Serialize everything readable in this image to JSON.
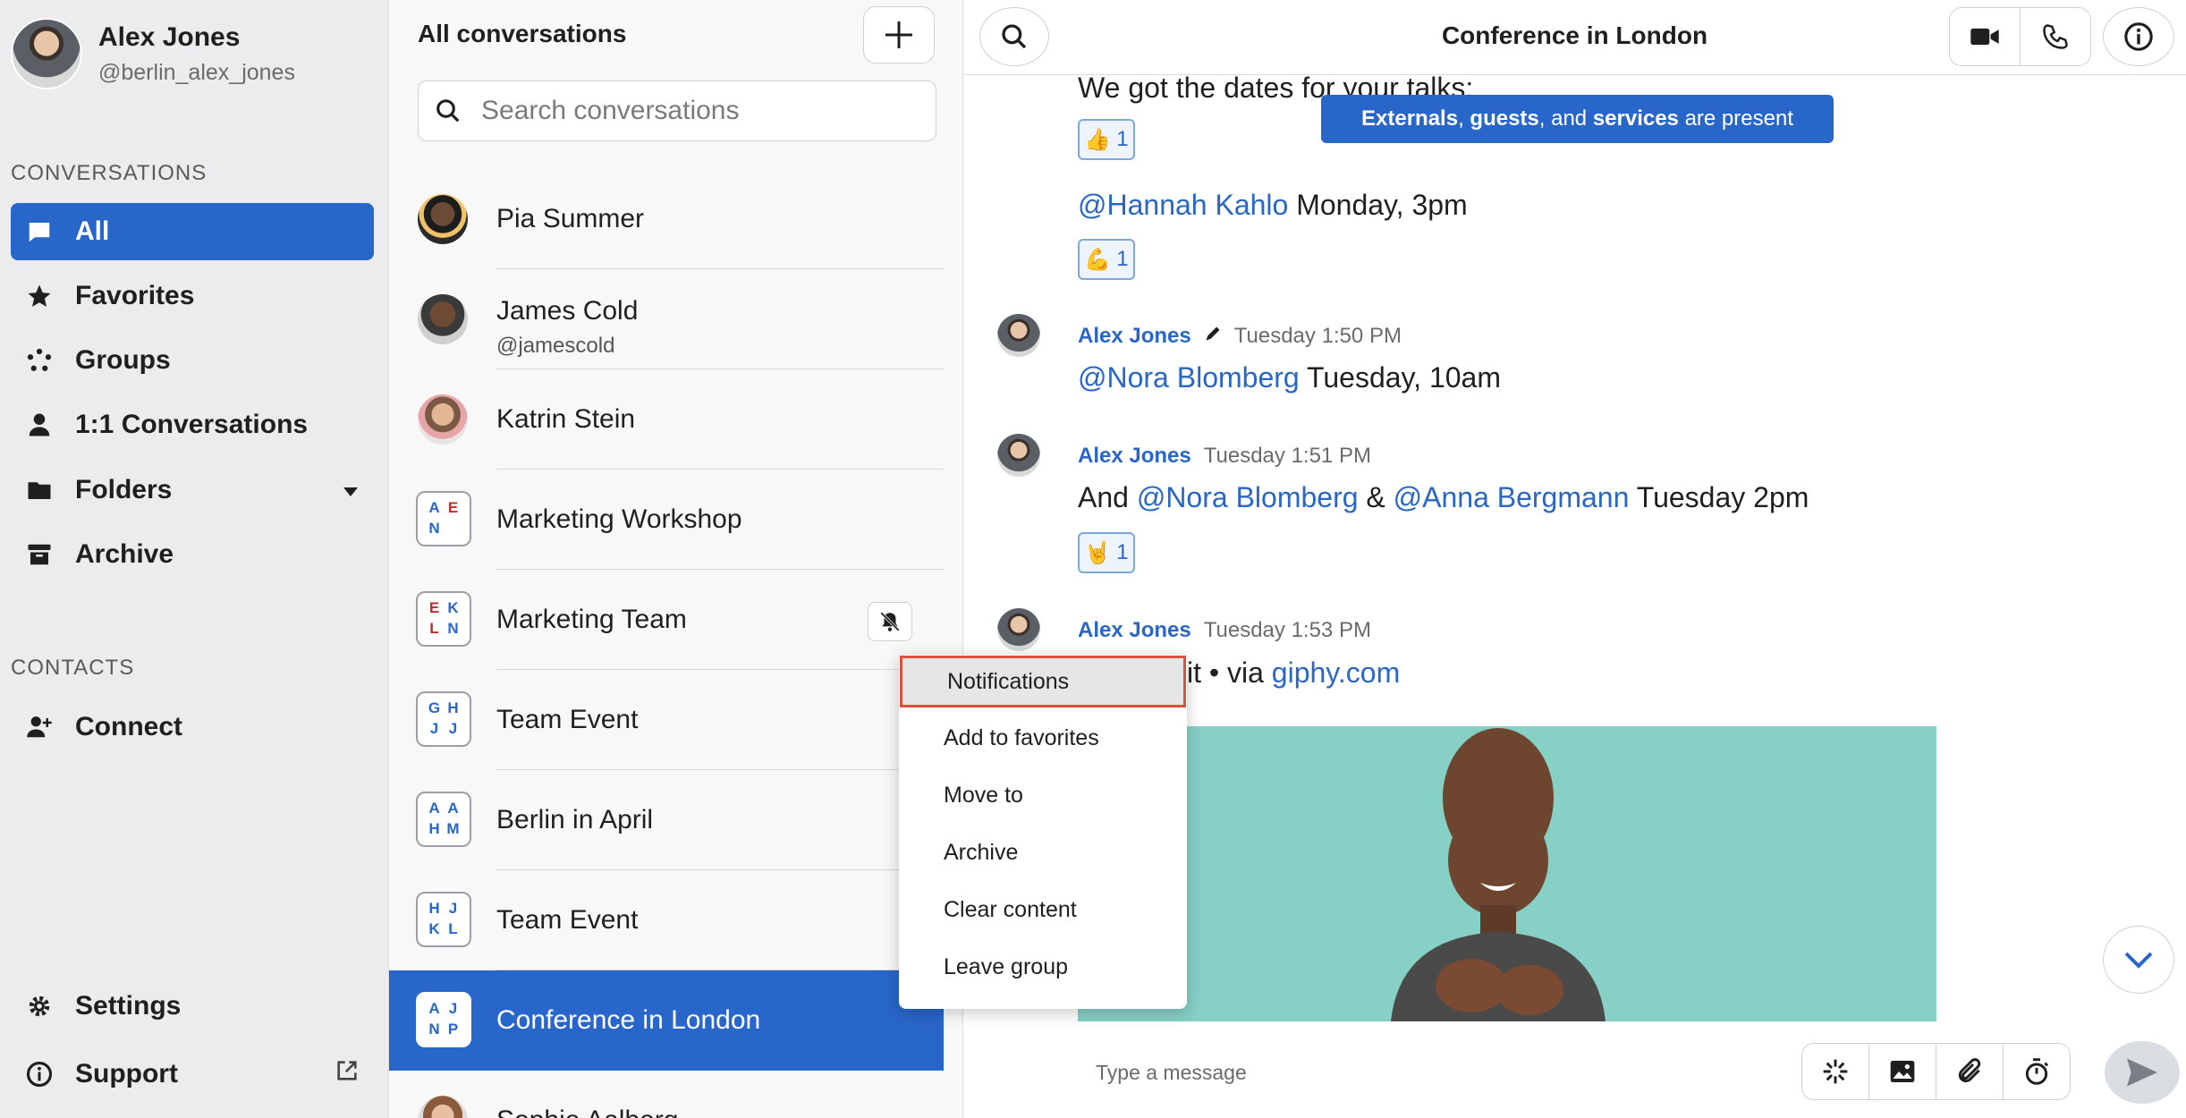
{
  "user": {
    "name": "Alex Jones",
    "handle": "@berlin_alex_jones"
  },
  "sidebar": {
    "conversations_label": "CONVERSATIONS",
    "items": [
      {
        "label": "All",
        "icon": "chat-bubble-icon",
        "active": true
      },
      {
        "label": "Favorites",
        "icon": "star-icon"
      },
      {
        "label": "Groups",
        "icon": "groups-icon"
      },
      {
        "label": "1:1 Conversations",
        "icon": "person-icon"
      },
      {
        "label": "Folders",
        "icon": "folder-icon"
      },
      {
        "label": "Archive",
        "icon": "archive-icon"
      }
    ],
    "contacts_label": "CONTACTS",
    "connect_label": "Connect",
    "settings_label": "Settings",
    "support_label": "Support"
  },
  "list": {
    "title": "All conversations",
    "search_placeholder": "Search conversations",
    "items": [
      {
        "name": "Pia Summer",
        "type": "person"
      },
      {
        "name": "James Cold",
        "sub": "@jamescold",
        "type": "person"
      },
      {
        "name": "Katrin Stein",
        "type": "person"
      },
      {
        "name": "Marketing Workshop",
        "type": "group",
        "initials": [
          "A",
          "E",
          "N",
          ""
        ]
      },
      {
        "name": "Marketing Team",
        "type": "group",
        "initials": [
          "E",
          "K",
          "L",
          "N"
        ],
        "muted": true
      },
      {
        "name": "Team Event",
        "type": "group",
        "initials": [
          "G",
          "H",
          "J",
          "J"
        ]
      },
      {
        "name": "Berlin in April",
        "type": "group",
        "initials": [
          "A",
          "A",
          "H",
          "M"
        ]
      },
      {
        "name": "Team Event",
        "type": "group",
        "initials": [
          "H",
          "J",
          "K",
          "L"
        ]
      },
      {
        "name": "Conference in London",
        "type": "group",
        "initials": [
          "A",
          "J",
          "N",
          "P"
        ],
        "selected": true
      },
      {
        "name": "Sophie Aalberg",
        "type": "person"
      }
    ]
  },
  "chat": {
    "title": "Conference in London",
    "banner": {
      "part1": "Externals",
      "sep1": ", ",
      "part2": "guests",
      "sep2": ", and ",
      "part3": "services",
      "tail": " are present"
    },
    "msg0": {
      "text": "We got the dates for your talks:",
      "reaction": "1"
    },
    "msg1": {
      "mention": "@Hannah Kahlo",
      "text": " Monday, 3pm",
      "reaction": "1"
    },
    "msg2": {
      "author": "Alex Jones",
      "time": "Tuesday 1:50 PM",
      "mention": "@Nora Blomberg",
      "text": " Tuesday, 10am"
    },
    "msg3": {
      "author": "Alex Jones",
      "time": "Tuesday 1:51 PM",
      "pre": "And ",
      "mention1": "@Nora Blomberg",
      "mid": " & ",
      "mention2": "@Anna Bergmann",
      "text": " Tuesday 2pm",
      "reaction": "1"
    },
    "msg4": {
      "author": "Alex Jones",
      "time": "Tuesday 1:53 PM",
      "text": "it • via ",
      "link": "giphy.com"
    },
    "composer_placeholder": "Type a message"
  },
  "context_menu": {
    "items": [
      "Notifications",
      "Add to favorites",
      "Move to",
      "Archive",
      "Clear content",
      "Leave group"
    ]
  },
  "colors": {
    "accent": "#2866c9",
    "mention": "#2a66c3",
    "highlight_border": "#d9533c"
  }
}
